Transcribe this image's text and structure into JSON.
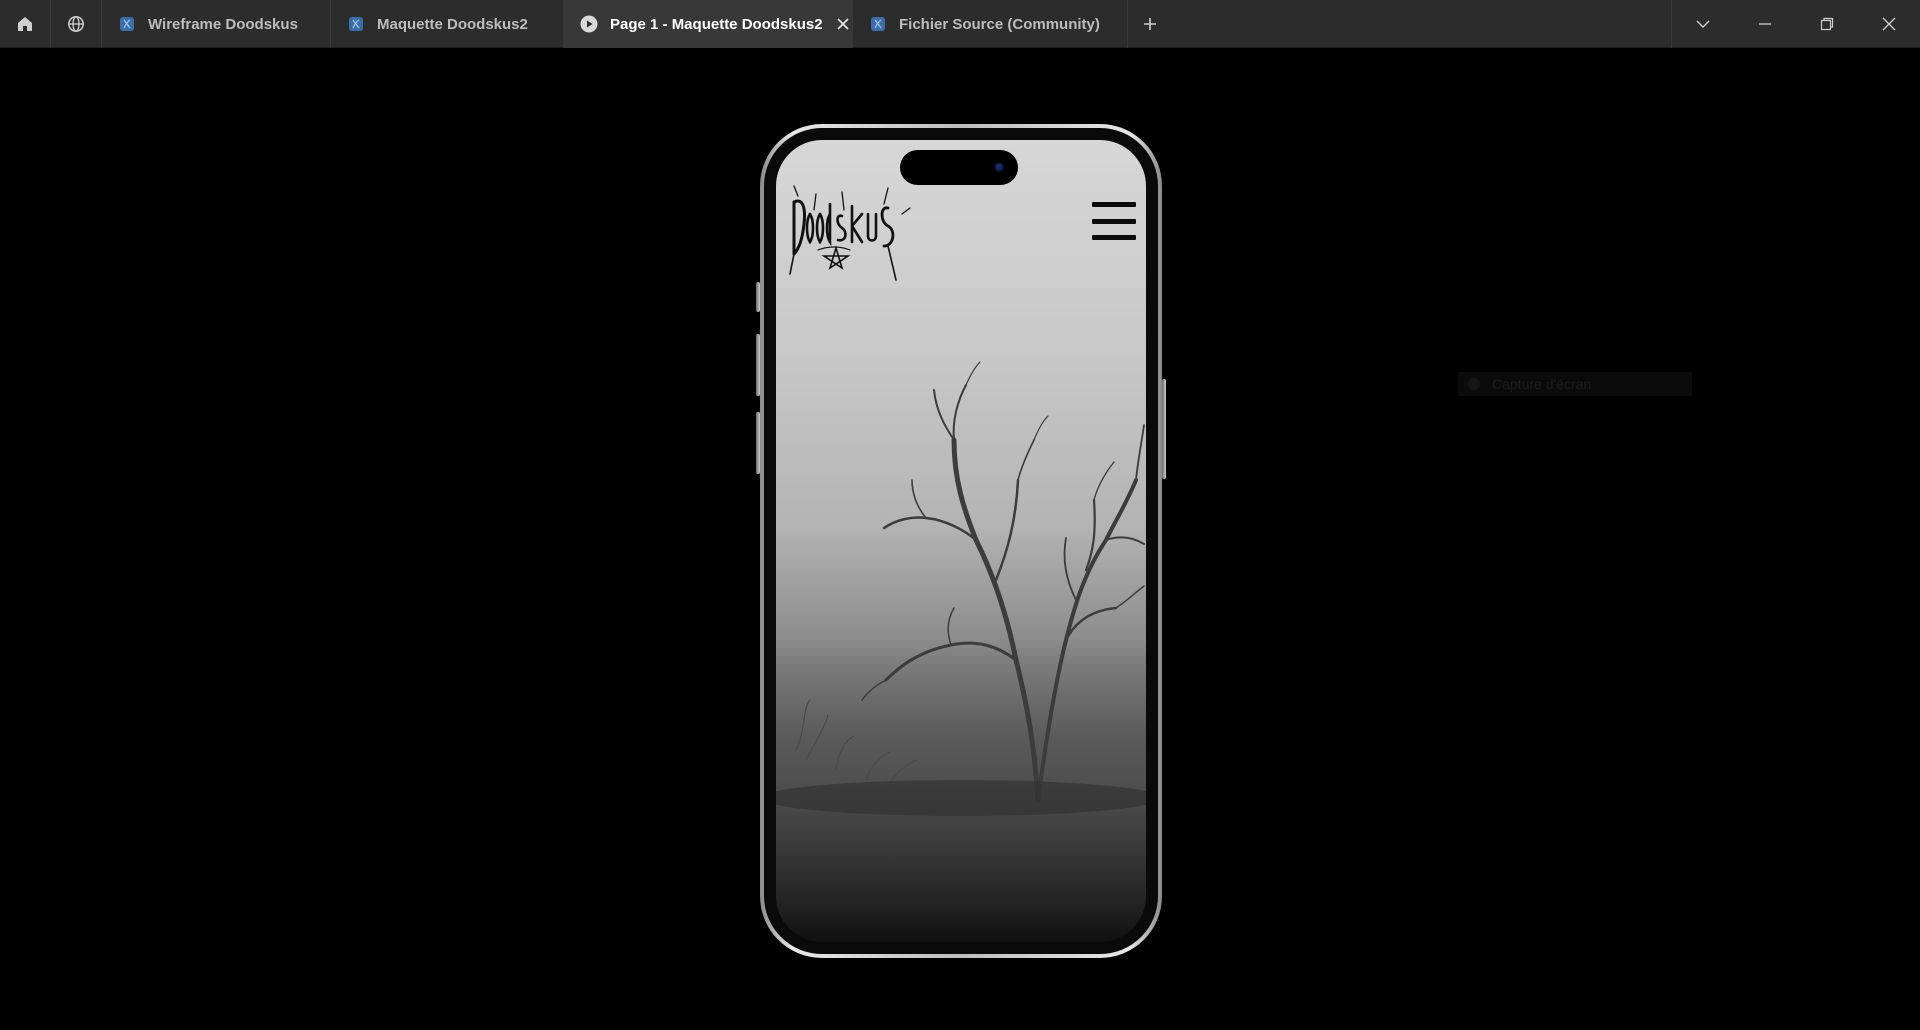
{
  "titlebar": {
    "tabs": [
      {
        "label": "Wireframe Doodskus",
        "icon": "figma-file-icon",
        "active": false
      },
      {
        "label": "Maquette Doodskus2",
        "icon": "figma-file-icon",
        "active": false
      },
      {
        "label": "Page 1 - Maquette Doodskus2",
        "icon": "play-prototype-icon",
        "active": true
      },
      {
        "label": "Fichier Source (Community)",
        "icon": "figma-file-icon",
        "active": false
      }
    ]
  },
  "prototype": {
    "logo_text": "Doodskus",
    "hidden_tooltip": "Capture d'écran"
  },
  "colors": {
    "titlebar_bg": "#2c2c2c",
    "active_tab_bg": "#383838",
    "canvas_bg": "#000000",
    "file_icon_blue": "#3b6ea8"
  }
}
